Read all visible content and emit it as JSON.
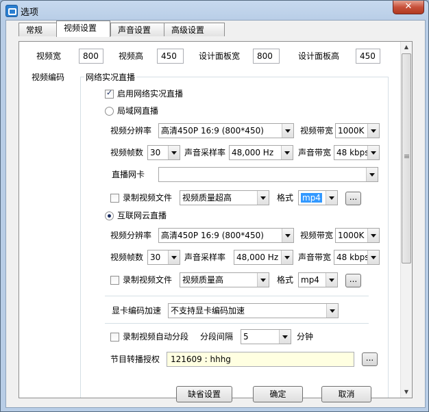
{
  "window": {
    "title": "选项"
  },
  "tabs": [
    {
      "label": "常规"
    },
    {
      "label": "视频设置"
    },
    {
      "label": "声音设置"
    },
    {
      "label": "高级设置"
    }
  ],
  "top": {
    "video_width_label": "视频宽",
    "video_width": "800",
    "video_height_label": "视频高",
    "video_height": "450",
    "panel_width_label": "设计面板宽",
    "panel_width": "800",
    "panel_height_label": "设计面板高",
    "panel_height": "450",
    "video_encoding_label": "视频编码"
  },
  "live": {
    "group_label": "网络实况直播",
    "enable_label": "启用网络实况直播",
    "lan_label": "局域网直播",
    "internet_label": "互联网云直播",
    "resolution_label": "视频分辨率",
    "video_bitrate_label": "视频带宽",
    "fps_label": "视频帧数",
    "sample_rate_label": "声音采样率",
    "audio_bitrate_label": "声音带宽",
    "nic_label": "直播网卡",
    "record_label": "录制视频文件",
    "format_label": "格式",
    "browse_label": "...",
    "lan": {
      "resolution": "高清450P 16:9 (800*450)",
      "video_bitrate": "1000K",
      "fps": "30",
      "sample_rate": "48,000 Hz",
      "audio_bitrate": "48 kbps",
      "nic": "",
      "quality": "视频质量超高",
      "format": "mp4"
    },
    "internet": {
      "resolution": "高清450P 16:9 (800*450)",
      "video_bitrate": "1000K",
      "fps": "30",
      "sample_rate": "48,000 Hz",
      "audio_bitrate": "48 kbps",
      "quality": "视频质量高",
      "format": "mp4"
    },
    "gpu_label": "显卡编码加速",
    "gpu_value": "不支持显卡编码加速",
    "auto_split_label": "录制视频自动分段",
    "split_interval_label": "分段间隔",
    "split_interval": "5",
    "split_unit": "分钟",
    "auth_label": "节目转播授权",
    "auth_value": "121609 : hhhg"
  },
  "footer": {
    "default_label": "缺省设置",
    "ok_label": "确定",
    "cancel_label": "取消"
  },
  "colors": {
    "title_bar": "#b8cde6",
    "close_button": "#c7503a",
    "selected_format": "#3399ff",
    "auth_field": "#ffffe1"
  }
}
